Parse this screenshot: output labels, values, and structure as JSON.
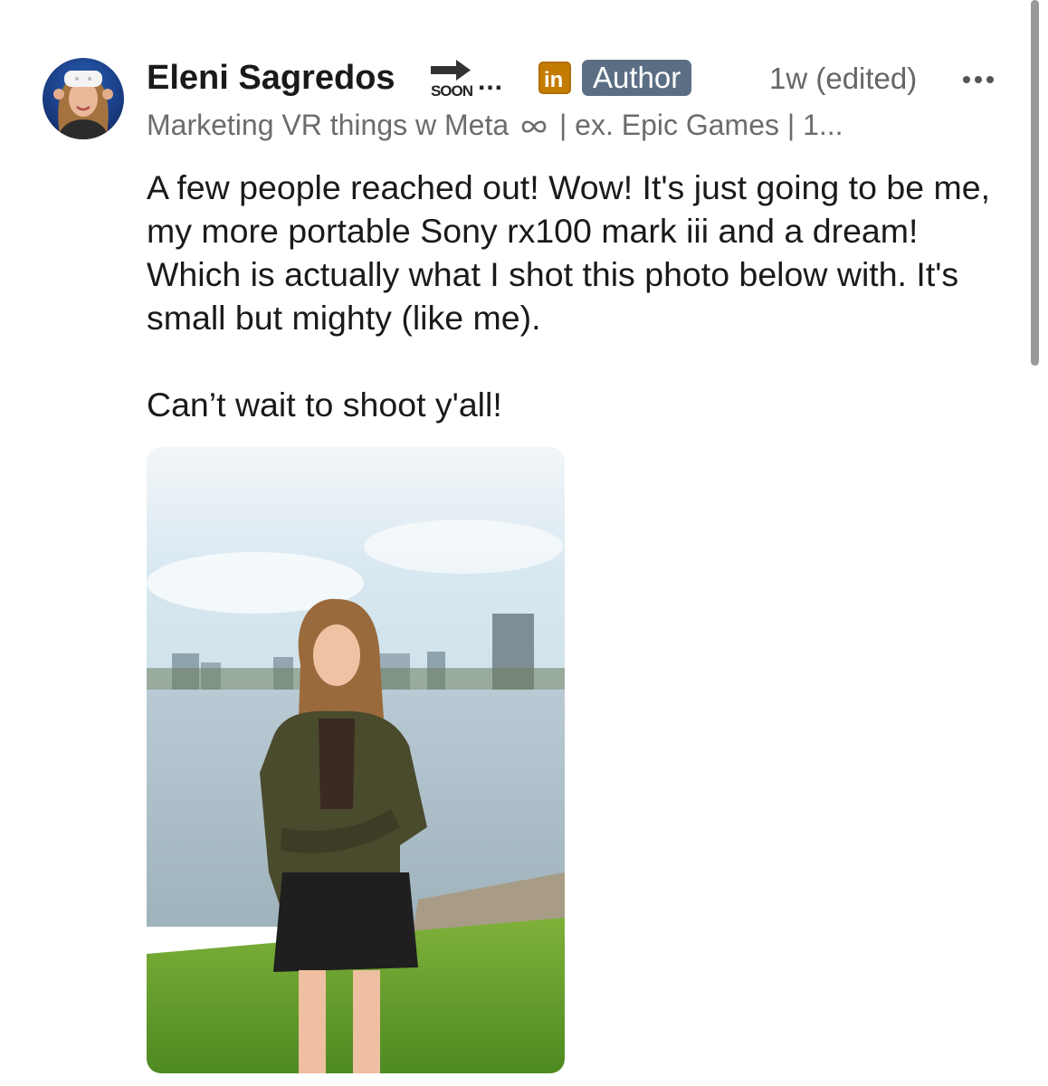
{
  "post": {
    "author_name": "Eleni Sagredos",
    "name_badge_text": "SOON",
    "name_overflow": "...",
    "linkedin_label": "in",
    "author_badge": "Author",
    "timestamp": "1w (edited)",
    "more_menu_icon": "more-horizontal-icon",
    "headline_before_icon": "Marketing VR things w Meta",
    "headline_icon": "infinity-icon",
    "headline_after_icon": "| ex. Epic Games | 1...",
    "body": "A few people reached out! Wow! It's just going to be me, my more portable Sony rx100 mark iii and a dream! Which is actually what I shot this photo below with. It's small but mighty (like me).\n\nCan’t wait to shoot y'all!"
  },
  "colors": {
    "author_badge_bg": "#5b6e83",
    "linkedin_icon_bg": "#c37c00",
    "secondary_text": "#6c6c6c"
  }
}
